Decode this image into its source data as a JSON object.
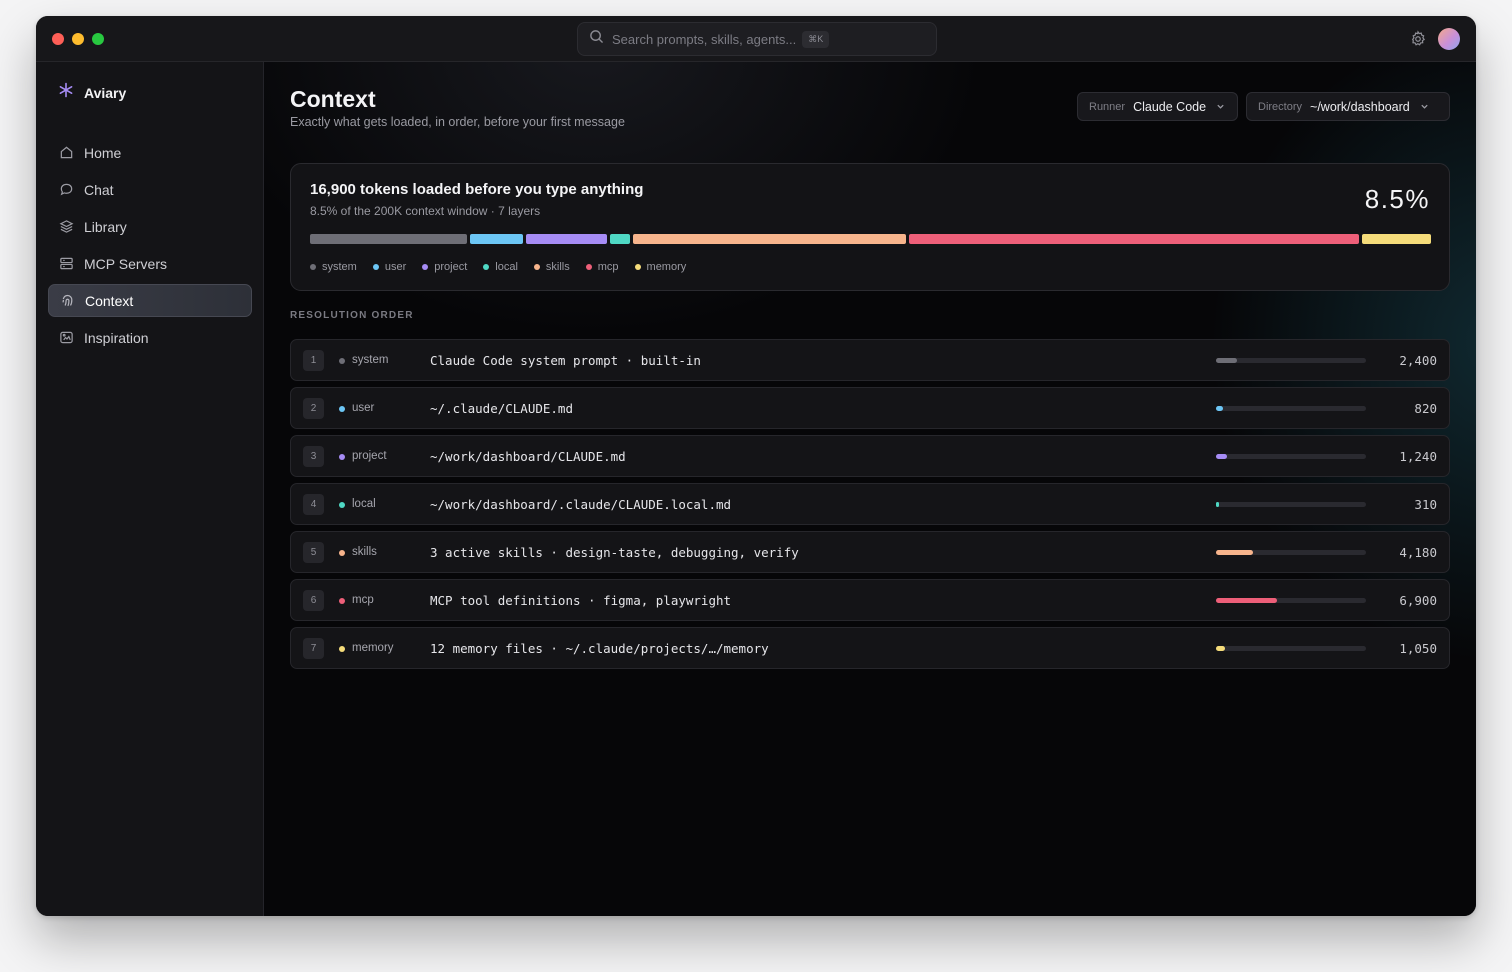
{
  "window": {
    "search": {
      "placeholder": "Search prompts, skills, agents...",
      "shortcut": "⌘K"
    }
  },
  "sidebar": {
    "brand": "Aviary",
    "items": [
      {
        "label": "Home",
        "icon": "home-icon"
      },
      {
        "label": "Chat",
        "icon": "chat-icon"
      },
      {
        "label": "Library",
        "icon": "layers-icon"
      },
      {
        "label": "MCP Servers",
        "icon": "server-icon"
      },
      {
        "label": "Context",
        "icon": "fingerprint-icon",
        "active": true
      },
      {
        "label": "Inspiration",
        "icon": "sparkle-icon"
      }
    ]
  },
  "header": {
    "title": "Context",
    "subtitle": "Exactly what gets loaded, in order, before your first message",
    "runner": {
      "label": "Runner",
      "value": "Claude Code"
    },
    "directory": {
      "label": "Directory",
      "value": "~/work/dashboard"
    }
  },
  "summary": {
    "title": "16,900 tokens loaded before you type anything",
    "subtitle": "8.5% of the 200K context window · 7 layers",
    "percent": "8.5%"
  },
  "section_label": "RESOLUTION ORDER",
  "layers": [
    {
      "num": "1",
      "name": "system",
      "color": "#6e6e76",
      "desc": "Claude Code system prompt · built-in",
      "tokens": "2,400",
      "value": 2400,
      "max": 16900
    },
    {
      "num": "2",
      "name": "user",
      "color": "#6cc6f5",
      "desc": "~/.claude/CLAUDE.md",
      "tokens": "820",
      "value": 820,
      "max": 16900
    },
    {
      "num": "3",
      "name": "project",
      "color": "#a68cf5",
      "desc": "~/work/dashboard/CLAUDE.md",
      "tokens": "1,240",
      "value": 1240,
      "max": 16900
    },
    {
      "num": "4",
      "name": "local",
      "color": "#4fd8c4",
      "desc": "~/work/dashboard/.claude/CLAUDE.local.md",
      "tokens": "310",
      "value": 310,
      "max": 16900
    },
    {
      "num": "5",
      "name": "skills",
      "color": "#f7b48c",
      "desc": "3 active skills · design-taste, debugging, verify",
      "tokens": "4,180",
      "value": 4180,
      "max": 16900
    },
    {
      "num": "6",
      "name": "mcp",
      "color": "#ee5f79",
      "desc": "MCP tool definitions · figma, playwright",
      "tokens": "6,900",
      "value": 6900,
      "max": 16900
    },
    {
      "num": "7",
      "name": "memory",
      "color": "#f5dc7a",
      "desc": "12 memory files · ~/.claude/projects/…/memory",
      "tokens": "1,050",
      "value": 1050,
      "max": 16900
    }
  ],
  "colors": {
    "accent": "#a68cf5",
    "background": "#060608"
  }
}
